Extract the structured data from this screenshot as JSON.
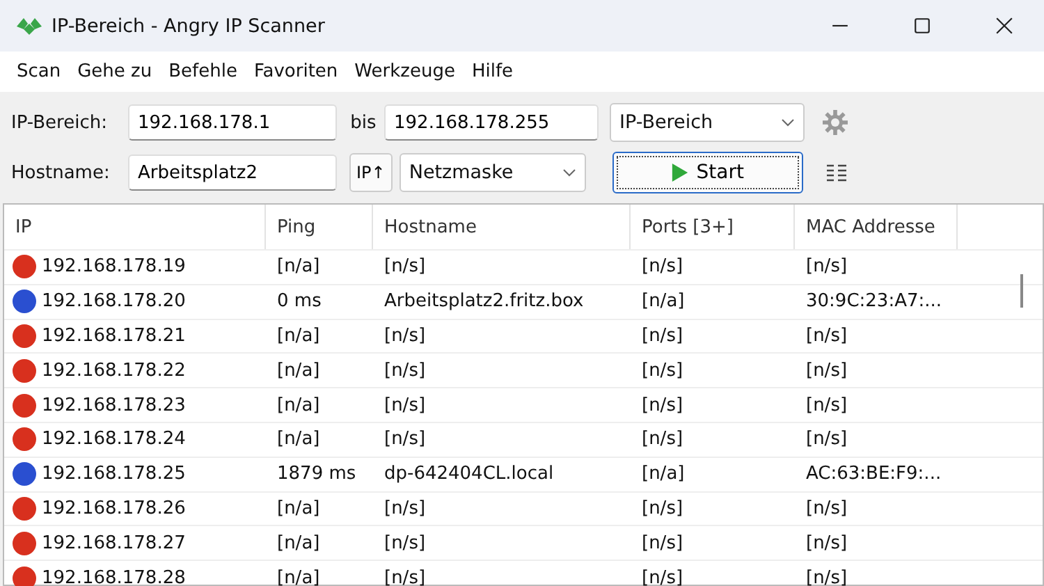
{
  "window": {
    "title": "IP-Bereich - Angry IP Scanner"
  },
  "menu": [
    "Scan",
    "Gehe zu",
    "Befehle",
    "Favoriten",
    "Werkzeuge",
    "Hilfe"
  ],
  "range": {
    "label": "IP-Bereich:",
    "from": "192.168.178.1",
    "to_label": "bis",
    "to": "192.168.178.255",
    "mode": "IP-Bereich"
  },
  "host": {
    "label": "Hostname:",
    "value": "Arbeitsplatz2",
    "ip_button": "IP↑",
    "mask": "Netzmaske",
    "start": "Start"
  },
  "table": {
    "columns": [
      "IP",
      "Ping",
      "Hostname",
      "Ports [3+]",
      "MAC Addresse"
    ],
    "rows": [
      {
        "color": "#d8301e",
        "cells": [
          "192.168.178.19",
          "[n/a]",
          "[n/s]",
          "[n/s]",
          "[n/s]"
        ]
      },
      {
        "color": "#2a4fd0",
        "cells": [
          "192.168.178.20",
          "0 ms",
          "Arbeitsplatz2.fritz.box",
          "[n/a]",
          "30:9C:23:A7:..."
        ]
      },
      {
        "color": "#d8301e",
        "cells": [
          "192.168.178.21",
          "[n/a]",
          "[n/s]",
          "[n/s]",
          "[n/s]"
        ]
      },
      {
        "color": "#d8301e",
        "cells": [
          "192.168.178.22",
          "[n/a]",
          "[n/s]",
          "[n/s]",
          "[n/s]"
        ]
      },
      {
        "color": "#d8301e",
        "cells": [
          "192.168.178.23",
          "[n/a]",
          "[n/s]",
          "[n/s]",
          "[n/s]"
        ]
      },
      {
        "color": "#d8301e",
        "cells": [
          "192.168.178.24",
          "[n/a]",
          "[n/s]",
          "[n/s]",
          "[n/s]"
        ]
      },
      {
        "color": "#2a4fd0",
        "cells": [
          "192.168.178.25",
          "1879 ms",
          "dp-642404CL.local",
          "[n/a]",
          "AC:63:BE:F9:..."
        ]
      },
      {
        "color": "#d8301e",
        "cells": [
          "192.168.178.26",
          "[n/a]",
          "[n/s]",
          "[n/s]",
          "[n/s]"
        ]
      },
      {
        "color": "#d8301e",
        "cells": [
          "192.168.178.27",
          "[n/a]",
          "[n/s]",
          "[n/s]",
          "[n/s]"
        ]
      },
      {
        "color": "#d8301e",
        "cells": [
          "192.168.178.28",
          "[n/a]",
          "[n/s]",
          "[n/s]",
          "[n/s]"
        ]
      }
    ]
  }
}
